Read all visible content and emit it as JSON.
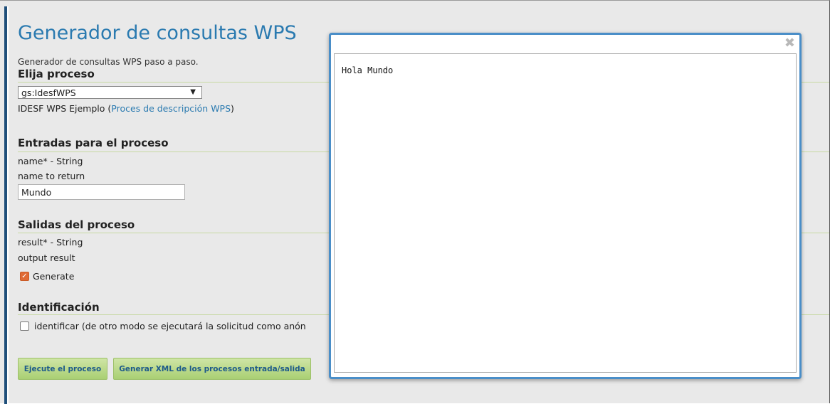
{
  "page": {
    "title": "Generador de consultas WPS",
    "subtitle": "Generador de consultas WPS paso a paso."
  },
  "process_section": {
    "heading": "Elija proceso",
    "selected_process": "gs:IdesfWPS",
    "description_prefix": "IDESF WPS Ejemplo (",
    "description_link": "Proces de descripción WPS",
    "description_suffix": ")"
  },
  "inputs_section": {
    "heading": "Entradas para el proceso",
    "param_label": "name* - String",
    "param_description": "name to return",
    "param_value": "Mundo"
  },
  "outputs_section": {
    "heading": "Salidas del proceso",
    "result_label": "result* - String",
    "result_description": "output result",
    "generate_label": "Generate",
    "generate_checked": true
  },
  "identification_section": {
    "heading": "Identificación",
    "identify_label": "identificar (de otro modo se ejecutará la solicitud como anón",
    "identify_checked": false
  },
  "buttons": {
    "execute": "Ejecute el proceso",
    "generate_xml": "Generar XML de los procesos entrada/salida"
  },
  "modal": {
    "close_glyph": "✖",
    "output": "Hola Mundo"
  },
  "colors": {
    "title": "#2a7ab0",
    "button_bg": "#b5d585",
    "checkbox_checked": "#e06b35",
    "modal_border": "#4a8ec8"
  }
}
